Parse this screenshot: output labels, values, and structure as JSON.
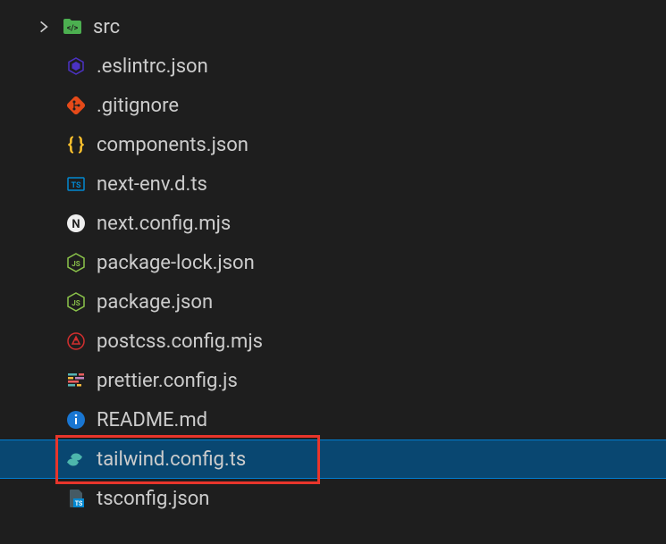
{
  "tree": {
    "folder": {
      "name": "src",
      "expanded": true
    },
    "files": [
      {
        "name": ".eslintrc.json",
        "icon": "eslint"
      },
      {
        "name": ".gitignore",
        "icon": "git"
      },
      {
        "name": "components.json",
        "icon": "json"
      },
      {
        "name": "next-env.d.ts",
        "icon": "ts-def"
      },
      {
        "name": "next.config.mjs",
        "icon": "next"
      },
      {
        "name": "package-lock.json",
        "icon": "nodejs"
      },
      {
        "name": "package.json",
        "icon": "nodejs"
      },
      {
        "name": "postcss.config.mjs",
        "icon": "postcss"
      },
      {
        "name": "prettier.config.js",
        "icon": "prettier"
      },
      {
        "name": "README.md",
        "icon": "info"
      },
      {
        "name": "tailwind.config.ts",
        "icon": "tailwind",
        "selected": true,
        "highlighted": true
      },
      {
        "name": "tsconfig.json",
        "icon": "tsconfig"
      }
    ]
  }
}
